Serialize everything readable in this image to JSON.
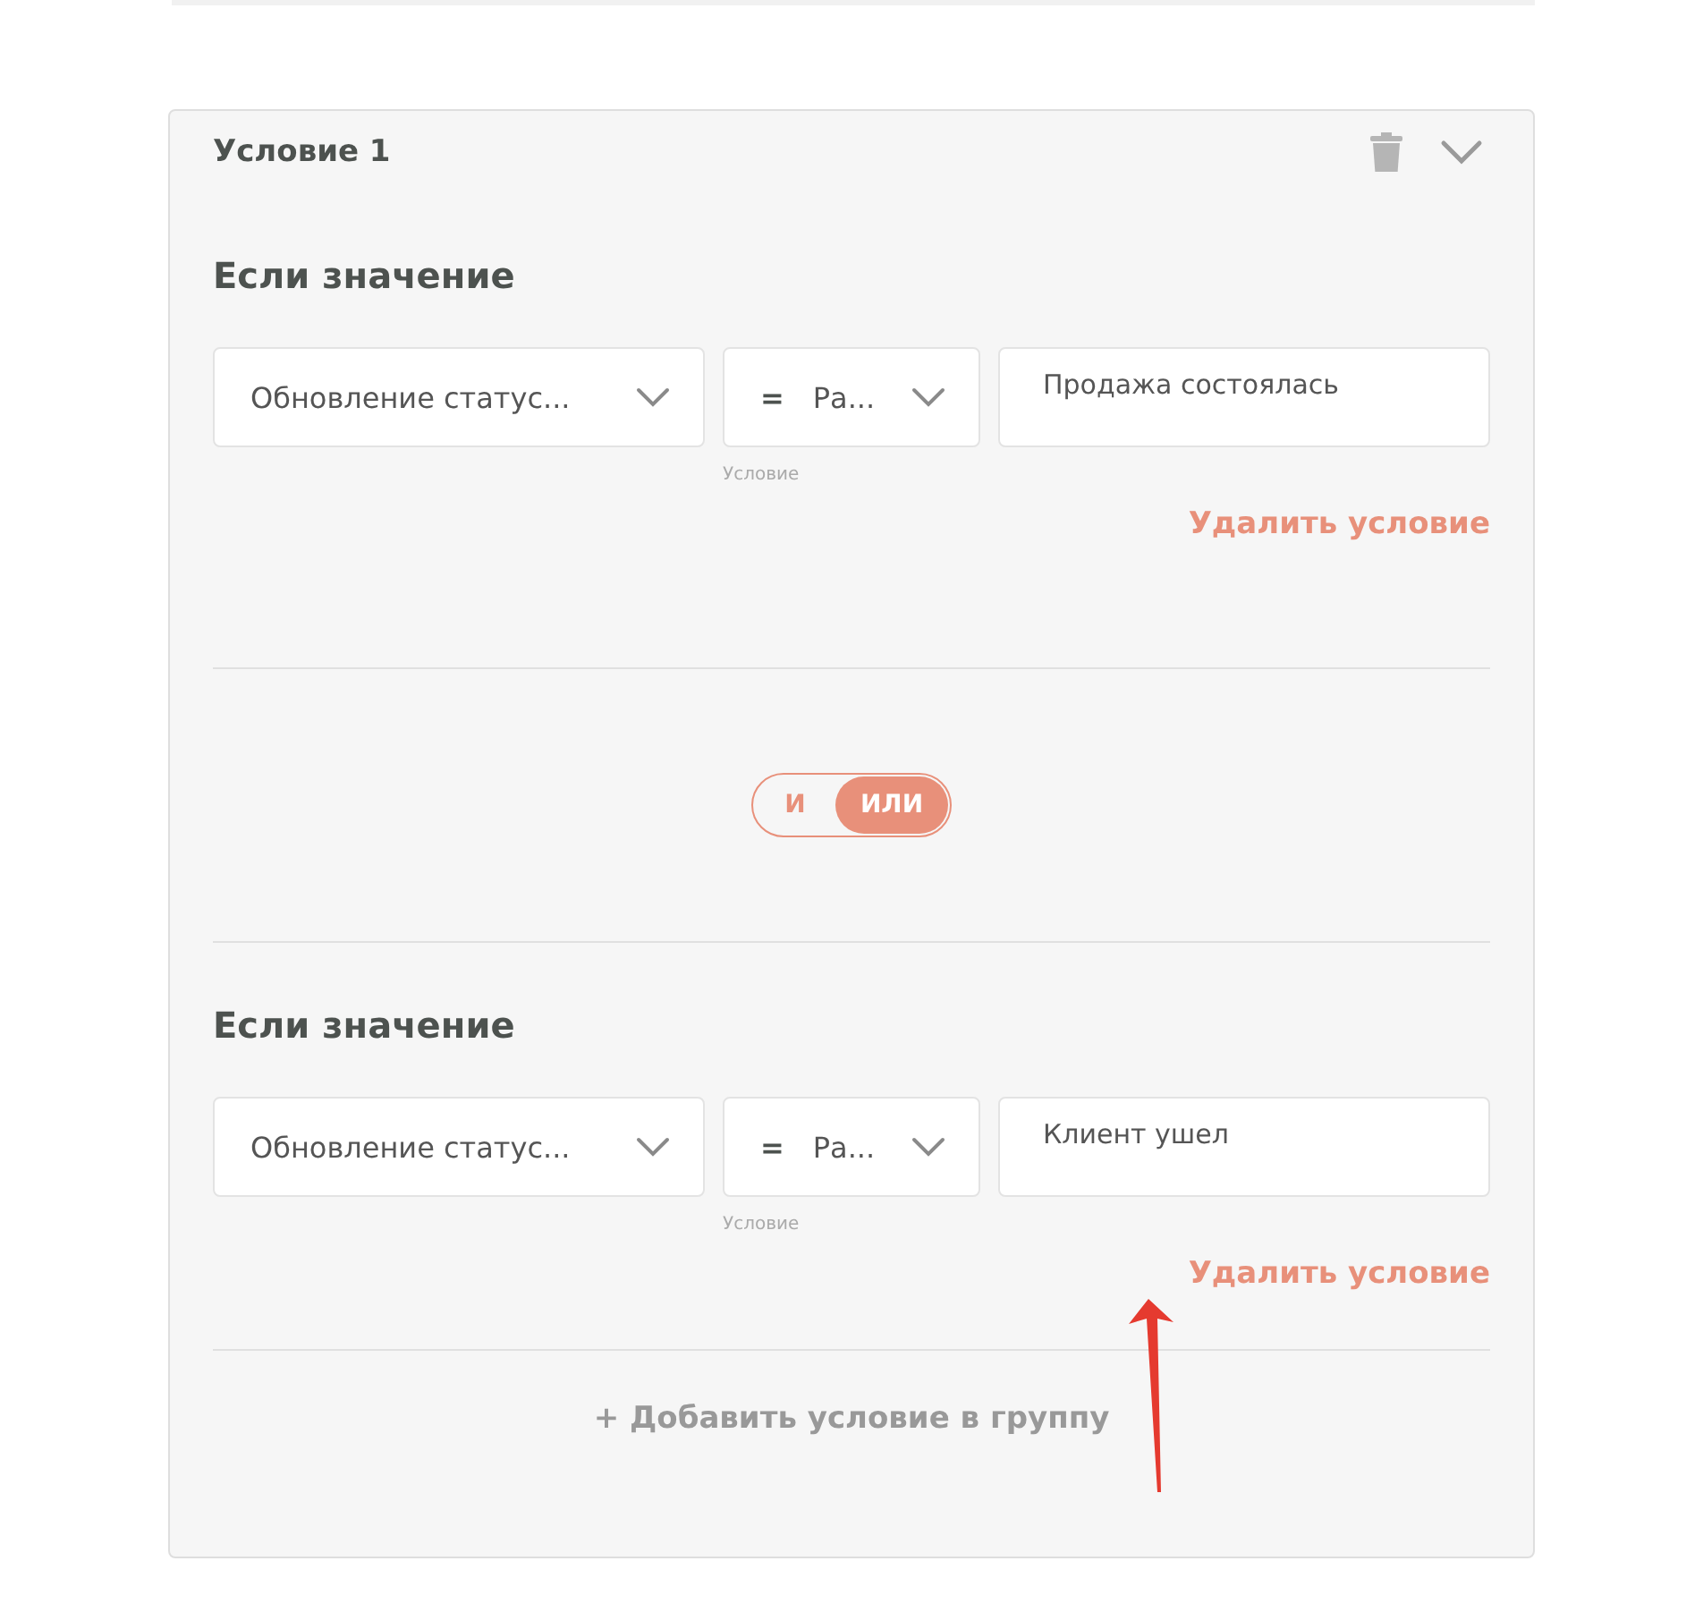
{
  "condition": {
    "title": "Условие 1",
    "groups": [
      {
        "heading": "Если значение",
        "field": "Обновление статус...",
        "operator_sign": "=",
        "operator": "Ра...",
        "operator_caption": "Условие",
        "value": "Продажа состоялась",
        "delete_label": "Удалить условие"
      },
      {
        "heading": "Если значение",
        "field": "Обновление статус...",
        "operator_sign": "=",
        "operator": "Ра...",
        "operator_caption": "Условие",
        "value": "Клиент ушел",
        "delete_label": "Удалить условие"
      }
    ],
    "connector": [
      {
        "label": "И",
        "selected": false
      },
      {
        "label": "ИЛИ",
        "selected": true
      }
    ],
    "add_label": "+ Добавить условие в группу"
  }
}
